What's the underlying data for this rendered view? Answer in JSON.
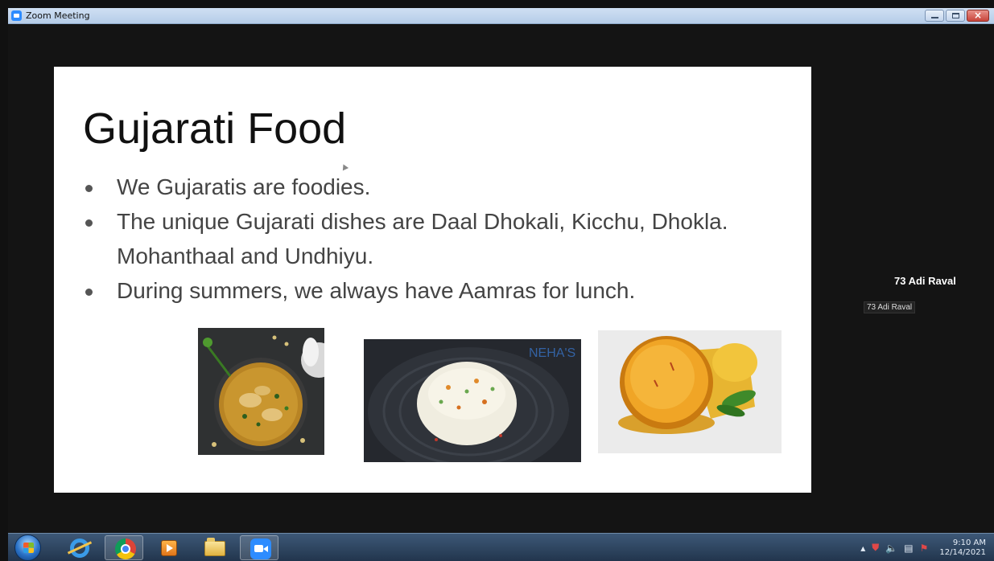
{
  "window": {
    "title": "Zoom Meeting",
    "close_glyph": "×"
  },
  "slide": {
    "title": "Gujarati Food",
    "bullets": [
      "We Gujaratis are foodies.",
      "The unique Gujarati dishes are Daal Dhokali, Kicchu, Dhokla. Mohanthaal and Undhiyu.",
      "During summers, we always have Aamras for lunch."
    ],
    "images": [
      "daal-dhokali-image",
      "dhokla-image",
      "aamras-image"
    ],
    "watermark": "NEHA'S"
  },
  "participant": {
    "name": "73 Adi Raval",
    "label": "73 Adi Raval"
  },
  "taskbar": {
    "apps": [
      "start-button",
      "internet-explorer-icon",
      "chrome-icon",
      "media-player-icon",
      "file-explorer-icon",
      "zoom-icon"
    ],
    "tray": {
      "arrow": "▴",
      "shield": "⛊",
      "volume": "🔈",
      "network": "▤",
      "flag": "⚑"
    },
    "clock": {
      "time": "9:10 AM",
      "date": "12/14/2021"
    }
  },
  "colors": {
    "zoom_blue": "#2d8cff",
    "meeting_bg": "#141414",
    "slide_bg": "#ffffff"
  }
}
